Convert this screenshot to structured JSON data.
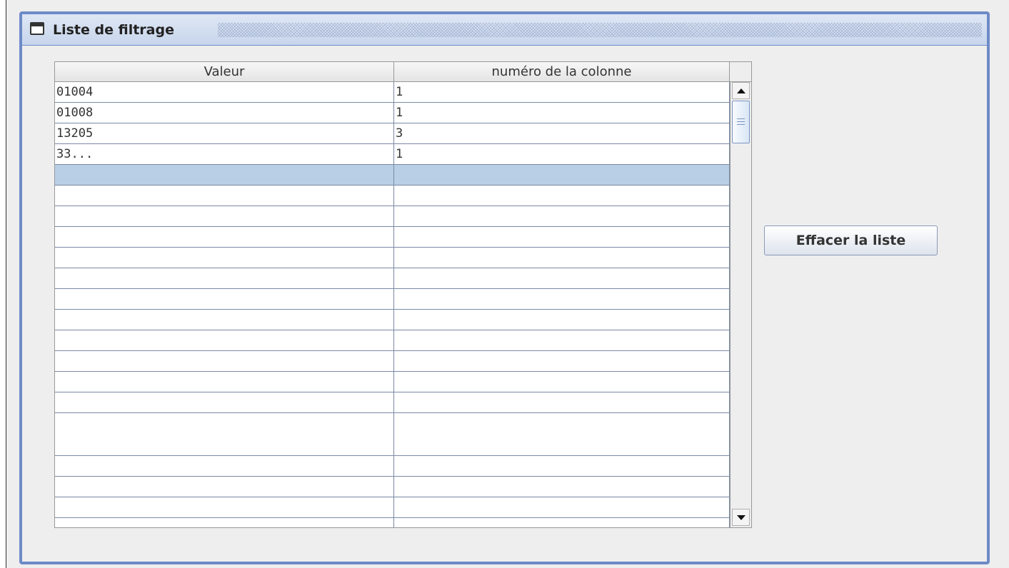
{
  "window": {
    "title": "Liste de filtrage",
    "title_icon": "window-icon",
    "accent_color": "#6e8ac7"
  },
  "table": {
    "columns": [
      "Valeur",
      "numéro de la colonne"
    ],
    "rows": [
      [
        "01004",
        "1"
      ],
      [
        "01008",
        "1"
      ],
      [
        "13205",
        "3"
      ],
      [
        "33...",
        "1"
      ]
    ],
    "selected_row_color": "#b8cfe5"
  },
  "actions": {
    "clear_label": "Effacer la liste"
  },
  "scrollbar": {
    "up_icon": "arrow-up-icon",
    "down_icon": "arrow-down-icon"
  }
}
